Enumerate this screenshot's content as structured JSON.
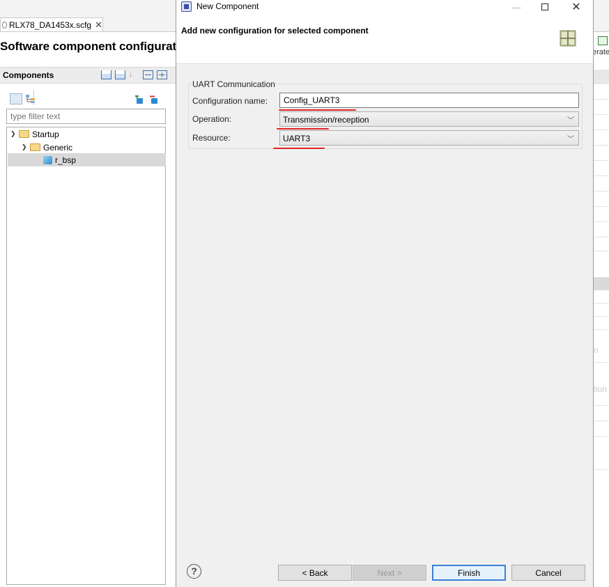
{
  "ide": {
    "editor_tab": "RLX78_DA1453x.scfg",
    "editor_tab_close": "✕",
    "page_title": "Software component configuratio",
    "components_title": "Components",
    "filter_placeholder": "type filter text",
    "tree": {
      "startup": "Startup",
      "generic": "Generic",
      "r_bsp": "r_bsp"
    },
    "right_strip": {
      "generate_label": "erate",
      "ghost_1": "n",
      "ghost_2": "ation"
    }
  },
  "dialog": {
    "window_title": "New Component",
    "banner_title": "Add new configuration for selected component",
    "group_title": "UART Communication",
    "fields": {
      "config_name_label": "Configuration name:",
      "config_name_value": "Config_UART3",
      "operation_label": "Operation:",
      "operation_value": "Transmission/reception",
      "resource_label": "Resource:",
      "resource_value": "UART3"
    },
    "buttons": {
      "help": "?",
      "back": "< Back",
      "next": "Next >",
      "finish": "Finish",
      "cancel": "Cancel"
    }
  },
  "colors": {
    "annotation_underline": "#e02424",
    "default_button_border": "#3c7fd6"
  },
  "icons": [
    "settings-icon",
    "close-icon",
    "chevron-down-icon",
    "folder-icon",
    "component-icon",
    "add-component-icon",
    "remove-component-icon",
    "collapse-all-icon",
    "expand-all-icon",
    "sort-icon",
    "help-icon",
    "component-grid-icon",
    "generate-code-icon"
  ]
}
